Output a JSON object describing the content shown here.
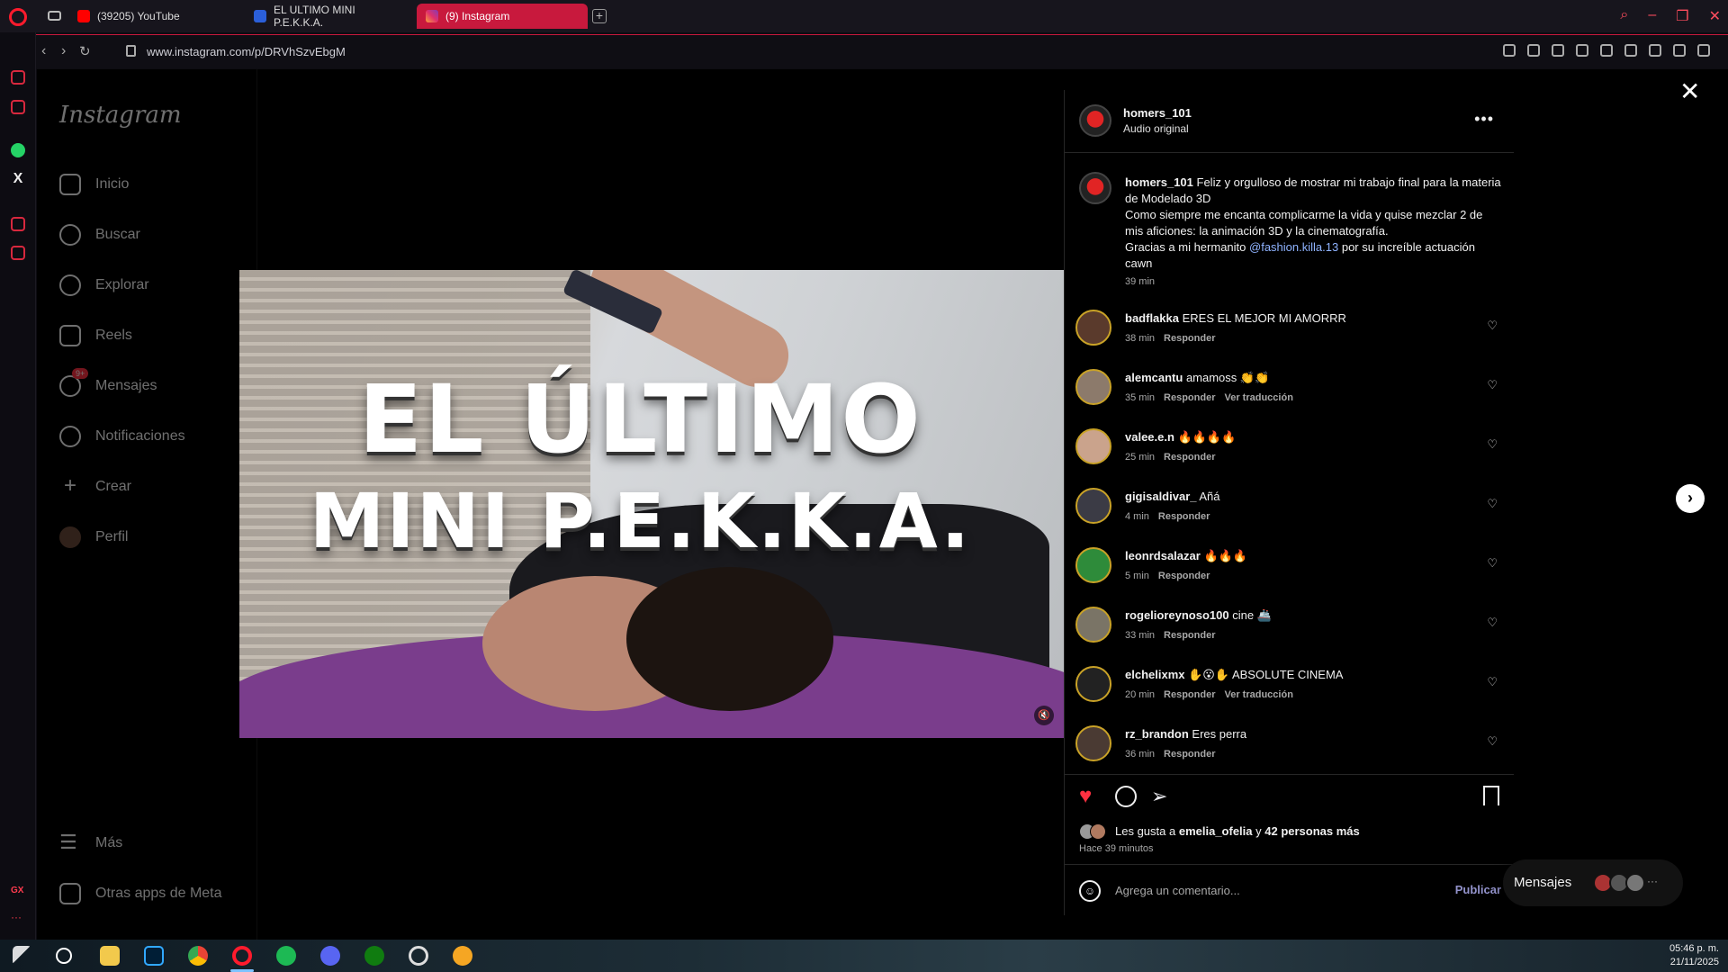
{
  "browser": {
    "tabs": [
      {
        "label": "(39205) YouTube",
        "favicon_color": "#ff0000"
      },
      {
        "label": "EL ULTIMO MINI P.E.K.K.A.",
        "favicon_color": "#2b5fd9"
      },
      {
        "label": "(9) Instagram",
        "favicon_color": "#e1306c"
      }
    ],
    "new_tab": "+",
    "url": "www.instagram.com/p/DRVhSzvEbgM",
    "accent": "#c8193d"
  },
  "ig_nav": {
    "logo": "Instagram",
    "items": [
      {
        "label": "Inicio",
        "icon": "home-icon"
      },
      {
        "label": "Buscar",
        "icon": "search-icon"
      },
      {
        "label": "Explorar",
        "icon": "compass-icon"
      },
      {
        "label": "Reels",
        "icon": "reels-icon"
      },
      {
        "label": "Mensajes",
        "icon": "messenger-icon",
        "badge": "9+"
      },
      {
        "label": "Notificaciones",
        "icon": "heart-icon"
      },
      {
        "label": "Crear",
        "icon": "plus-icon"
      },
      {
        "label": "Perfil",
        "icon": "profile-avatar"
      }
    ],
    "bottom": [
      {
        "label": "Más",
        "icon": "menu-icon"
      },
      {
        "label": "Otras apps de Meta",
        "icon": "apps-icon"
      }
    ]
  },
  "video": {
    "line1": "EL ÚLTIMO",
    "line2": "MINI P.E.K.K.A."
  },
  "post": {
    "username": "homers_101",
    "audio": "Audio original",
    "caption_user": "homers_101",
    "caption_line1": "Feliz y orgulloso de mostrar mi trabajo final para la materia de Modelado 3D",
    "caption_line2": "Como siempre me encanta complicarme la vida y quise mezclar 2 de mis aficiones: la animación 3D y la cinematografía.",
    "caption_line3a": "Gracias a mi hermanito",
    "caption_mention": "@fashion.killa.13",
    "caption_line3b": "por su increíble actuación",
    "caption_line4": "cawn",
    "caption_time": "39 min",
    "reply_label": "Responder",
    "translate_label": "Ver traducción"
  },
  "comments": [
    {
      "user": "badflakka",
      "text": "ERES EL MEJOR MI AMORRR",
      "time": "38 min",
      "translate": false,
      "avatar_color": "#5a3a2c"
    },
    {
      "user": "alemcantu",
      "text": "amamoss 👏👏",
      "time": "35 min",
      "translate": true,
      "avatar_color": "#8c7a6b"
    },
    {
      "user": "valee.e.n",
      "text": "🔥🔥🔥🔥",
      "time": "25 min",
      "translate": false,
      "avatar_color": "#caa38c"
    },
    {
      "user": "gigisaldivar_",
      "text": "Añá",
      "time": "4 min",
      "translate": false,
      "avatar_color": "#3b3b45"
    },
    {
      "user": "leonrdsalazar",
      "text": "🔥🔥🔥",
      "time": "5 min",
      "translate": false,
      "avatar_color": "#2e8b3a"
    },
    {
      "user": "rogelioreynoso100",
      "text": "cine 🚢",
      "time": "33 min",
      "translate": false,
      "avatar_color": "#7a7466"
    },
    {
      "user": "elchelixmx",
      "text": "✋😮✋ ABSOLUTE CINEMA",
      "time": "20 min",
      "translate": true,
      "avatar_color": "#222"
    },
    {
      "user": "rz_brandon",
      "text": "Eres perra",
      "time": "36 min",
      "translate": false,
      "avatar_color": "#4a3a33"
    }
  ],
  "likes": {
    "prefix": "Les gusta a",
    "user": "emelia_ofelia",
    "joiner": "y",
    "others": "42 personas más",
    "time_ago": "Hace 39 minutos"
  },
  "add_comment": {
    "placeholder": "Agrega un comentario...",
    "publish": "Publicar"
  },
  "messages_pill": {
    "label": "Mensajes",
    "more": "···"
  },
  "taskbar": {
    "time": "05:46 p. m.",
    "date": "21/11/2025"
  },
  "opera_sidebar": {
    "gx_label": "GX",
    "more": "···"
  }
}
